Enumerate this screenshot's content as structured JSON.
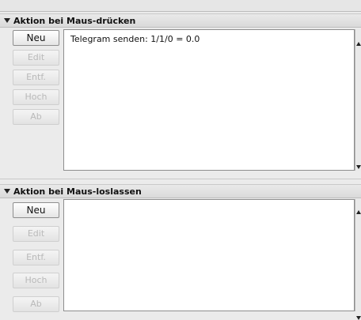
{
  "press_section": {
    "title": "Aktion bei Maus-drücken",
    "buttons": {
      "new": "Neu",
      "edit": "Edit",
      "remove": "Entf.",
      "up": "Hoch",
      "down": "Ab"
    },
    "items": [
      "Telegram senden: 1/1/0 = 0.0"
    ]
  },
  "release_section": {
    "title": "Aktion bei Maus-loslassen",
    "buttons": {
      "new": "Neu",
      "edit": "Edit",
      "remove": "Entf.",
      "up": "Hoch",
      "down": "Ab"
    },
    "items": []
  },
  "icons": {
    "collapse": "triangle-down-icon",
    "scroll_up": "scroll-up-arrow-icon",
    "scroll_down": "scroll-down-arrow-icon"
  }
}
